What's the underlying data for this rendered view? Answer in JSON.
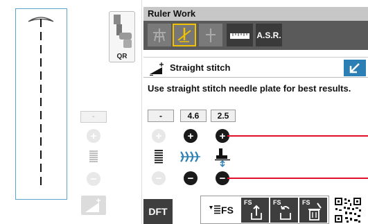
{
  "left_panel": {
    "presser_foot_label": "QR",
    "minus_value_label": "-"
  },
  "header": {
    "title": "Ruler Work"
  },
  "mode_bar": {
    "asr_label": "A.S.R."
  },
  "stitch": {
    "name": "Straight stitch",
    "advice": "Use straight stitch needle plate for best results."
  },
  "values": {
    "left": "-",
    "width": "4.6",
    "length": "2.5"
  },
  "bottom_bar": {
    "dft_label": "DFT",
    "fs_label": "FS",
    "fs_save_label": "FS",
    "fs_recall_label": "FS",
    "fs_delete_label": "FS"
  },
  "colors": {
    "accent_blue": "#2b7fb4",
    "highlight_yellow": "#f2c200",
    "indicator_red": "#e0102a",
    "dark_button": "#3e3e3e"
  },
  "icons": [
    "presser-foot-icon",
    "needle-up-icon",
    "needle-bar-icon",
    "needle-down-icon",
    "ruler-icon",
    "straight-stitch-icon",
    "expand-icon",
    "plus-icon",
    "minus-icon",
    "lines-icon",
    "tension-icon",
    "presser-height-icon",
    "edit-icon",
    "fs-save-icon",
    "fs-recall-icon",
    "fs-delete-icon",
    "qr-code-icon"
  ]
}
